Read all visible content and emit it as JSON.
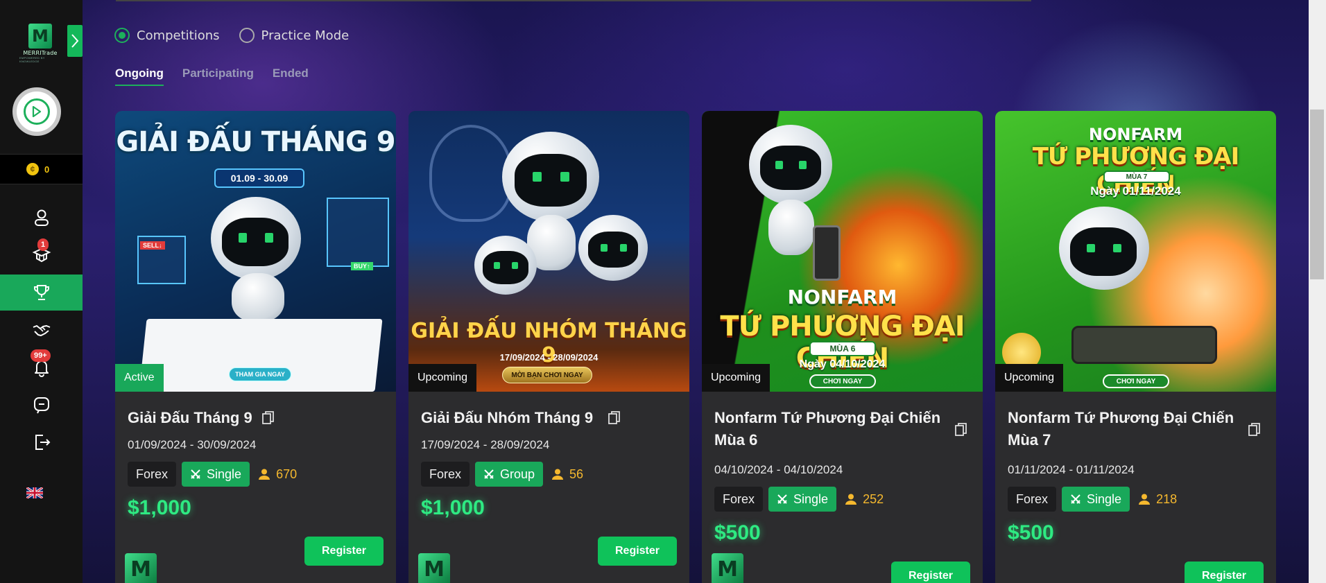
{
  "brand": {
    "logo_text": "MERRITrade",
    "logo_sub": "EMPOWERED BY KNOWLEDGE",
    "mark": "M"
  },
  "sidebar": {
    "coins": "0",
    "items": [
      {
        "name": "profile",
        "icon": "user-icon"
      },
      {
        "name": "courses",
        "icon": "graduation-cap-icon",
        "badge": "1"
      },
      {
        "name": "competitions",
        "icon": "trophy-icon",
        "active": true
      },
      {
        "name": "partners",
        "icon": "handshake-icon"
      },
      {
        "name": "notifications",
        "icon": "bell-icon",
        "badge": "99+"
      },
      {
        "name": "support",
        "icon": "chat-icon"
      },
      {
        "name": "logout",
        "icon": "logout-icon"
      }
    ],
    "language": "en-gb-flag"
  },
  "mode": {
    "options": [
      "Competitions",
      "Practice Mode"
    ],
    "selected": "Competitions"
  },
  "tabs": [
    "Ongoing",
    "Participating",
    "Ended"
  ],
  "active_tab": "Ongoing",
  "colors": {
    "accent": "#19a85a",
    "prize": "#2eea82",
    "participants": "#f5b82e"
  },
  "cards": [
    {
      "banner": {
        "title": "GIẢI ĐẤU THÁNG 9",
        "date": "01.09 - 30.09",
        "cta": "THAM GIA NGAY",
        "sell": "SELL↓",
        "buy": "BUY↑"
      },
      "status": "Active",
      "title": "Giải Đấu Tháng 9",
      "dates": "01/09/2024 - 30/09/2024",
      "market": "Forex",
      "type": "Single",
      "participants": "670",
      "prize": "$1,000",
      "register": "Register"
    },
    {
      "banner": {
        "title": "GIẢI ĐẤU NHÓM THÁNG 9",
        "date": "17/09/2024 - 28/09/2024",
        "cta": "MỜI BẠN CHƠI NGAY"
      },
      "status": "Upcoming",
      "title": "Giải Đấu Nhóm Tháng 9",
      "dates": "17/09/2024 - 28/09/2024",
      "market": "Forex",
      "type": "Group",
      "participants": "56",
      "prize": "$1,000",
      "register": "Register"
    },
    {
      "banner": {
        "title_a": "NONFARM",
        "title_b": "TỨ PHƯƠNG ĐẠI CHIẾN",
        "season": "MÙA 6",
        "date": "Ngày 04/10/2024",
        "cta": "CHƠI NGAY"
      },
      "status": "Upcoming",
      "title": "Nonfarm Tứ Phương Đại Chiến Mùa 6",
      "dates": "04/10/2024 - 04/10/2024",
      "market": "Forex",
      "type": "Single",
      "participants": "252",
      "prize": "$500",
      "register": "Register"
    },
    {
      "banner": {
        "title_a": "NONFARM",
        "title_b": "TỨ PHƯƠNG ĐẠI CHIẾN",
        "season": "MÙA 7",
        "date": "Ngày 01/11/2024",
        "cta": "CHƠI NGAY"
      },
      "status": "Upcoming",
      "title": "Nonfarm Tứ Phương Đại Chiến Mùa 7",
      "dates": "01/11/2024 - 01/11/2024",
      "market": "Forex",
      "type": "Single",
      "participants": "218",
      "prize": "$500",
      "register": "Register"
    }
  ]
}
